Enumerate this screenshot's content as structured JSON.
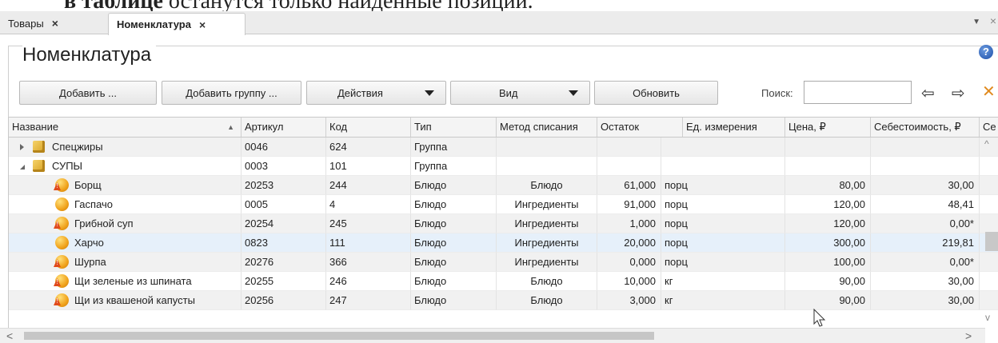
{
  "caption": {
    "bold": "в таблице",
    "rest": " останутся только найденные позиции."
  },
  "tabs": [
    {
      "label": "Товары",
      "close": "×"
    },
    {
      "label": "Номенклатура",
      "close": "×"
    }
  ],
  "tab_menu": {
    "arrow": "▼",
    "close": "×"
  },
  "page": {
    "title": "Номенклатура",
    "help": "?"
  },
  "toolbar": {
    "add": "Добавить ...",
    "add_group": "Добавить группу ...",
    "actions": "Действия",
    "view": "Вид",
    "refresh": "Обновить",
    "search_label": "Поиск:",
    "search_value": ""
  },
  "icons": {
    "back": "⇦",
    "forward": "⇨",
    "clear": "✕",
    "folder": "folder-icon",
    "dish": "dish-icon"
  },
  "columns": [
    {
      "label": "Название"
    },
    {
      "label": "Артикул"
    },
    {
      "label": "Код"
    },
    {
      "label": "Тип"
    },
    {
      "label": "Метод списания"
    },
    {
      "label": "Остаток"
    },
    {
      "label": "Ед. измерения"
    },
    {
      "label": "Цена, ₽"
    },
    {
      "label": "Себестоимость, ₽"
    },
    {
      "label": "Се"
    }
  ],
  "rows": [
    {
      "name": "Спецжиры",
      "article": "0046",
      "code": "624",
      "type": "Группа",
      "method": "",
      "stock": "",
      "unit": "",
      "price": "",
      "cost": "",
      "kind": "group",
      "expanded": false
    },
    {
      "name": "СУПЫ",
      "article": "0003",
      "code": "101",
      "type": "Группа",
      "method": "",
      "stock": "",
      "unit": "",
      "price": "",
      "cost": "",
      "kind": "group",
      "expanded": true
    },
    {
      "name": "Борщ",
      "article": "20253",
      "code": "244",
      "type": "Блюдо",
      "method": "Блюдо",
      "stock": "61,000",
      "unit": "порц",
      "price": "80,00",
      "cost": "30,00",
      "kind": "dish",
      "warn": true
    },
    {
      "name": "Гаспачо",
      "article": "0005",
      "code": "4",
      "type": "Блюдо",
      "method": "Ингредиенты",
      "stock": "91,000",
      "unit": "порц",
      "price": "120,00",
      "cost": "48,41",
      "kind": "dish",
      "warn": false
    },
    {
      "name": "Грибной суп",
      "article": "20254",
      "code": "245",
      "type": "Блюдо",
      "method": "Ингредиенты",
      "stock": "1,000",
      "unit": "порц",
      "price": "120,00",
      "cost": "0,00*",
      "kind": "dish",
      "warn": true
    },
    {
      "name": "Харчо",
      "article": "0823",
      "code": "111",
      "type": "Блюдо",
      "method": "Ингредиенты",
      "stock": "20,000",
      "unit": "порц",
      "price": "300,00",
      "cost": "219,81",
      "kind": "dish",
      "warn": false,
      "selected": true
    },
    {
      "name": "Шурпа",
      "article": "20276",
      "code": "366",
      "type": "Блюдо",
      "method": "Ингредиенты",
      "stock": "0,000",
      "unit": "порц",
      "price": "100,00",
      "cost": "0,00*",
      "kind": "dish",
      "warn": true
    },
    {
      "name": "Щи зеленые из шпината",
      "article": "20255",
      "code": "246",
      "type": "Блюдо",
      "method": "Блюдо",
      "stock": "10,000",
      "unit": "кг",
      "price": "90,00",
      "cost": "30,00",
      "kind": "dish",
      "warn": true
    },
    {
      "name": "Щи из квашеной капусты",
      "article": "20256",
      "code": "247",
      "type": "Блюдо",
      "method": "Блюдо",
      "stock": "3,000",
      "unit": "кг",
      "price": "90,00",
      "cost": "30,00",
      "kind": "dish",
      "warn": true
    }
  ],
  "scroll": {
    "up": "^",
    "down": "v",
    "left": "<",
    "right": ">"
  }
}
